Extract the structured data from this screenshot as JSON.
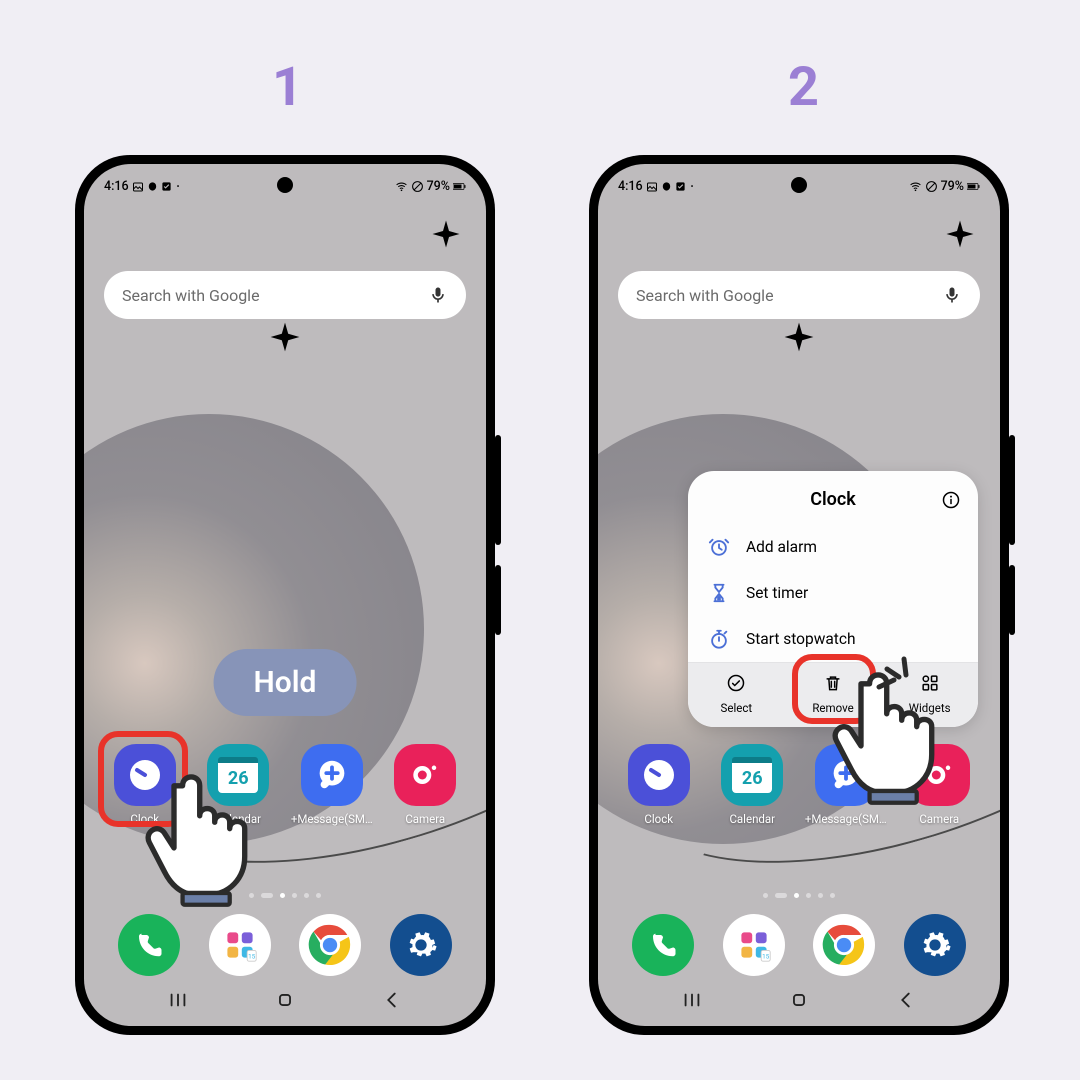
{
  "steps": {
    "s1": "1",
    "s2": "2"
  },
  "status": {
    "time": "4:16",
    "battery": "79%"
  },
  "search": {
    "placeholder": "Search with Google"
  },
  "hold_label": "Hold",
  "apps1": [
    {
      "label": "Clock",
      "color": "#4B50D8"
    },
    {
      "label": "Calendar",
      "color": "#14A0AE",
      "day": "26"
    },
    {
      "label": "+Message(SM…",
      "color": "#3E6DF0"
    },
    {
      "label": "Camera",
      "color": "#E9215A"
    }
  ],
  "apps2": [
    {
      "label": "Clock",
      "color": "#4B50D8"
    },
    {
      "label": "Calendar",
      "color": "#14A0AE",
      "day": "26"
    },
    {
      "label": "+Message(SM…",
      "color": "#3E6DF0"
    },
    {
      "label": "Camera",
      "color": "#E9215A"
    }
  ],
  "dock": [
    {
      "name": "phone",
      "color": "#19B35A"
    },
    {
      "name": "apps",
      "color": "#FFFFFF"
    },
    {
      "name": "chrome",
      "color": "#FFFFFF"
    },
    {
      "name": "settings",
      "color": "#134E8F"
    }
  ],
  "popup": {
    "title": "Clock",
    "items": [
      {
        "label": "Add alarm",
        "icon": "alarm"
      },
      {
        "label": "Set timer",
        "icon": "hourglass"
      },
      {
        "label": "Start stopwatch",
        "icon": "stopwatch"
      }
    ],
    "actions": [
      {
        "label": "Select",
        "icon": "check"
      },
      {
        "label": "Remove",
        "icon": "trash"
      },
      {
        "label": "Widgets",
        "icon": "widgets"
      }
    ]
  }
}
